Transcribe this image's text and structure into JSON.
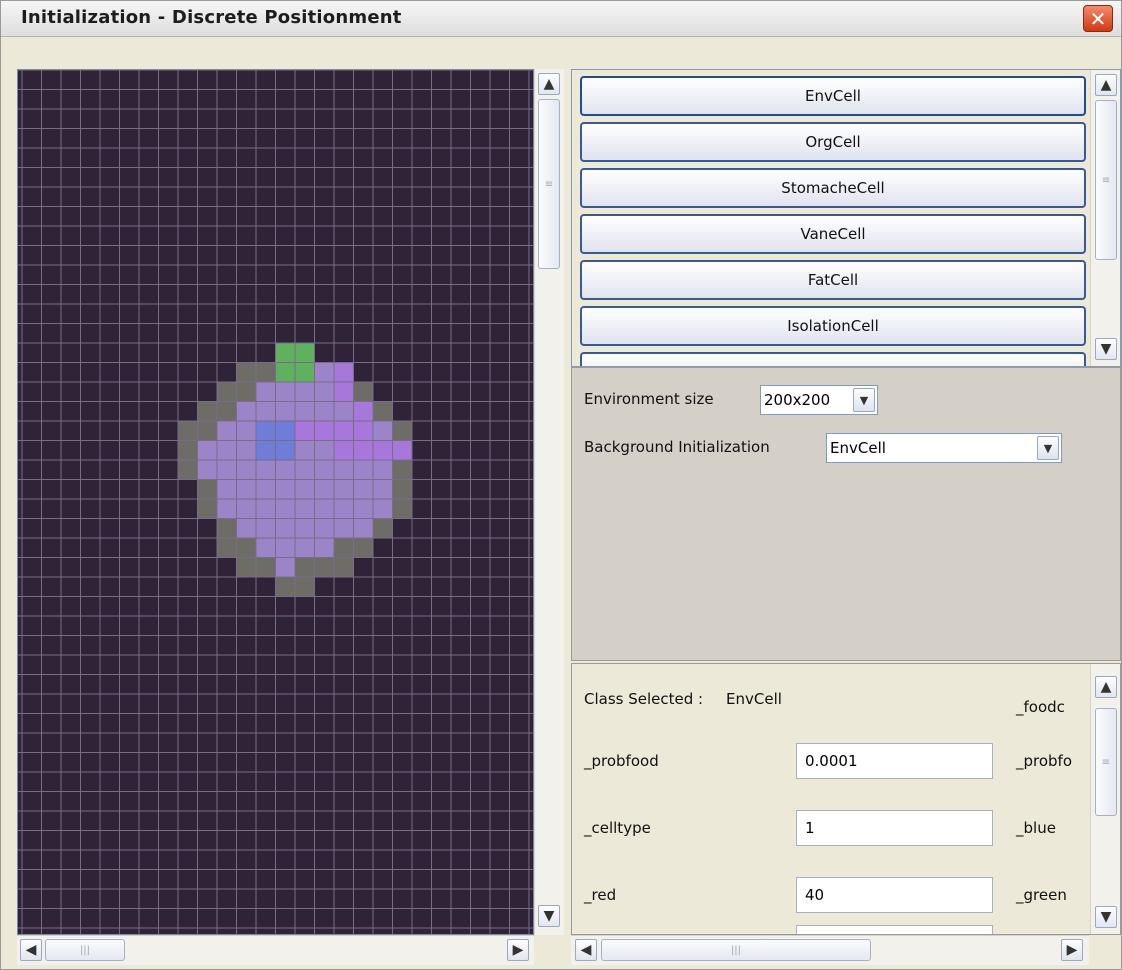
{
  "window": {
    "title": "Initialization - Discrete Positionment",
    "close_glyph": "✕"
  },
  "icons": {
    "up": "▲",
    "down": "▼",
    "left": "◀",
    "right": "▶",
    "grip_v": "≡",
    "grip_h": "|||",
    "combo_arrow": "▼"
  },
  "grid": {
    "colors": {
      "background": "#2f2337",
      "grid_line": "#7a6c88",
      "membrane": "#6e6c66",
      "body": "#9b84c8",
      "nucleus": "#6f7dd8",
      "vessel": "#a777dc",
      "head": "#5fb05f"
    }
  },
  "classes": [
    "EnvCell",
    "OrgCell",
    "StomacheCell",
    "VaneCell",
    "FatCell",
    "IsolationCell"
  ],
  "settings": {
    "env_size_label": "Environment size",
    "env_size_value": "200x200",
    "background_label": "Background Initialization",
    "background_value": "EnvCell"
  },
  "properties": {
    "class_selected_label": "Class Selected :",
    "class_selected_value": "EnvCell",
    "rows": [
      {
        "name": "_probfood",
        "value": "0.0001"
      },
      {
        "name": "_celltype",
        "value": "1"
      },
      {
        "name": "_red",
        "value": "40"
      }
    ],
    "right_column": [
      "_foodc",
      "_probfo",
      "_blue",
      "_green"
    ]
  }
}
